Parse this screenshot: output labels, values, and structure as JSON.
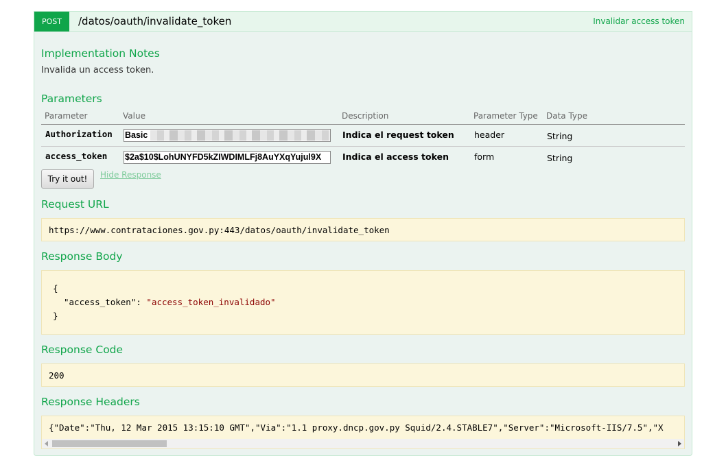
{
  "operation": {
    "method": "POST",
    "path": "/datos/oauth/invalidate_token",
    "summary": "Invalidar access token"
  },
  "implementation_notes": {
    "title": "Implementation Notes",
    "text": "Invalida un access token."
  },
  "parameters": {
    "title": "Parameters",
    "headers": [
      "Parameter",
      "Value",
      "Description",
      "Parameter Type",
      "Data Type"
    ],
    "rows": [
      {
        "name": "Authorization",
        "value": "Basic",
        "description": "Indica el request token",
        "param_type": "header",
        "data_type": "String"
      },
      {
        "name": "access_token",
        "value": "$2a$10$LohUNYFD5kZIWDIMLFj8AuYXqYujul9X",
        "description": "Indica el access token",
        "param_type": "form",
        "data_type": "String"
      }
    ]
  },
  "actions": {
    "try_label": "Try it out!",
    "hide_label": "Hide Response"
  },
  "request_url": {
    "title": "Request URL",
    "value": "https://www.contrataciones.gov.py:443/datos/oauth/invalidate_token"
  },
  "response_body": {
    "title": "Response Body",
    "open": "{",
    "key": "\"access_token\"",
    "colon": ": ",
    "value": "\"access_token_invalidado\"",
    "close": "}"
  },
  "response_code": {
    "title": "Response Code",
    "value": "200"
  },
  "response_headers": {
    "title": "Response Headers",
    "value": "{\"Date\":\"Thu, 12 Mar 2015 13:15:10 GMT\",\"Via\":\"1.1 proxy.dncp.gov.py Squid/2.4.STABLE7\",\"Server\":\"Microsoft-IIS/7.5\",\"X"
  },
  "colors": {
    "accent": "#10a54a",
    "panel_bg": "#ebf3f0",
    "code_bg": "#fcf6db"
  }
}
